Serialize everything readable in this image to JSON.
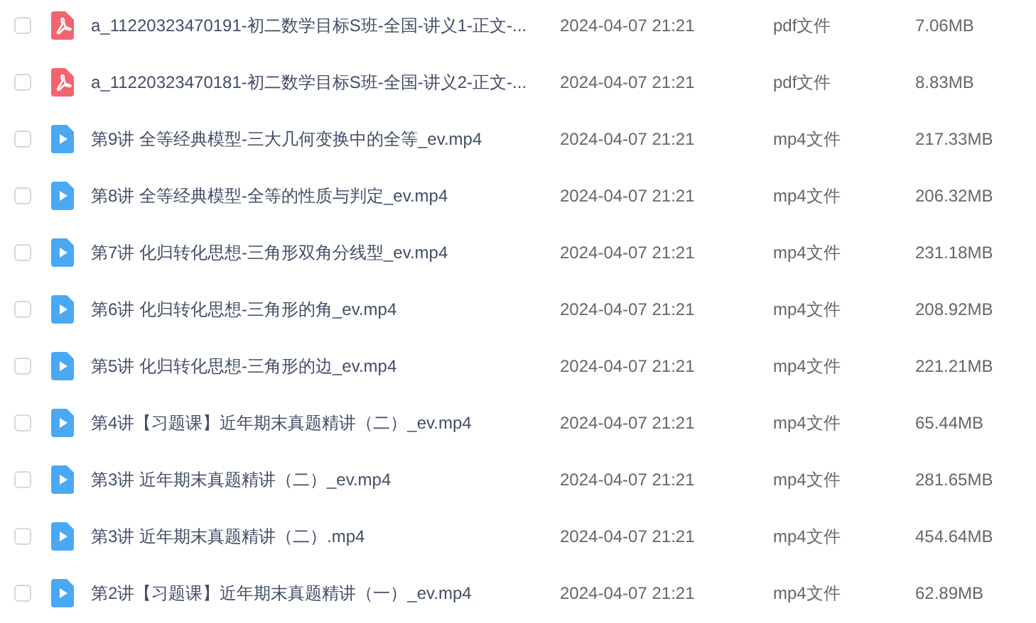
{
  "files": [
    {
      "kind": "pdf",
      "name": "a_11220323470191-初二数学目标S班-全国-讲义1-正文-...",
      "modified": "2024-04-07 21:21",
      "type": "pdf文件",
      "size": "7.06MB",
      "checked": false
    },
    {
      "kind": "pdf",
      "name": "a_11220323470181-初二数学目标S班-全国-讲义2-正文-...",
      "modified": "2024-04-07 21:21",
      "type": "pdf文件",
      "size": "8.83MB",
      "checked": false
    },
    {
      "kind": "video",
      "name": "第9讲 全等经典模型-三大几何变换中的全等_ev.mp4",
      "modified": "2024-04-07 21:21",
      "type": "mp4文件",
      "size": "217.33MB",
      "checked": false
    },
    {
      "kind": "video",
      "name": "第8讲 全等经典模型-全等的性质与判定_ev.mp4",
      "modified": "2024-04-07 21:21",
      "type": "mp4文件",
      "size": "206.32MB",
      "checked": false
    },
    {
      "kind": "video",
      "name": "第7讲 化归转化思想-三角形双角分线型_ev.mp4",
      "modified": "2024-04-07 21:21",
      "type": "mp4文件",
      "size": "231.18MB",
      "checked": false
    },
    {
      "kind": "video",
      "name": "第6讲 化归转化思想-三角形的角_ev.mp4",
      "modified": "2024-04-07 21:21",
      "type": "mp4文件",
      "size": "208.92MB",
      "checked": false
    },
    {
      "kind": "video",
      "name": "第5讲 化归转化思想-三角形的边_ev.mp4",
      "modified": "2024-04-07 21:21",
      "type": "mp4文件",
      "size": "221.21MB",
      "checked": false
    },
    {
      "kind": "video",
      "name": "第4讲【习题课】近年期末真题精讲（二）_ev.mp4",
      "modified": "2024-04-07 21:21",
      "type": "mp4文件",
      "size": "65.44MB",
      "checked": false
    },
    {
      "kind": "video",
      "name": "第3讲 近年期末真题精讲（二）_ev.mp4",
      "modified": "2024-04-07 21:21",
      "type": "mp4文件",
      "size": "281.65MB",
      "checked": false
    },
    {
      "kind": "video",
      "name": "第3讲 近年期末真题精讲（二）.mp4",
      "modified": "2024-04-07 21:21",
      "type": "mp4文件",
      "size": "454.64MB",
      "checked": false
    },
    {
      "kind": "video",
      "name": "第2讲【习题课】近年期末真题精讲（一）_ev.mp4",
      "modified": "2024-04-07 21:21",
      "type": "mp4文件",
      "size": "62.89MB",
      "checked": false
    }
  ]
}
